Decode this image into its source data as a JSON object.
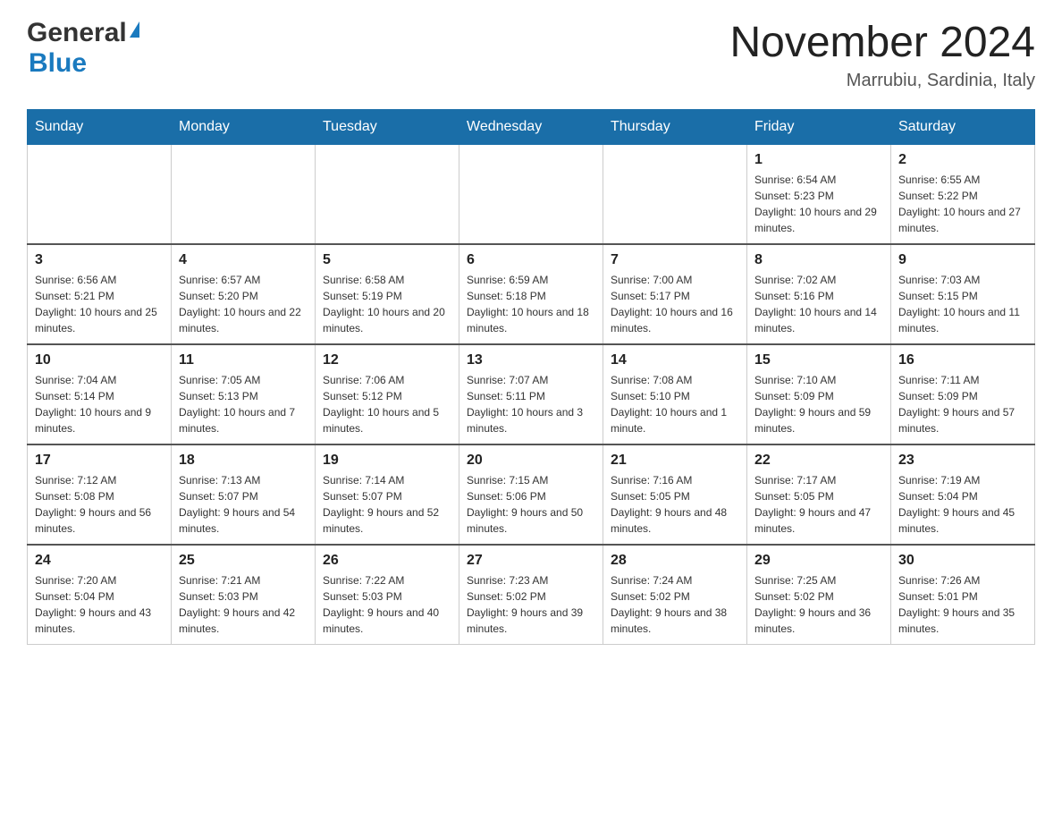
{
  "header": {
    "logo_general": "General",
    "logo_blue": "Blue",
    "month_title": "November 2024",
    "location": "Marrubiu, Sardinia, Italy"
  },
  "weekdays": [
    "Sunday",
    "Monday",
    "Tuesday",
    "Wednesday",
    "Thursday",
    "Friday",
    "Saturday"
  ],
  "weeks": [
    {
      "days": [
        {
          "number": "",
          "sunrise": "",
          "sunset": "",
          "daylight": "",
          "empty": true
        },
        {
          "number": "",
          "sunrise": "",
          "sunset": "",
          "daylight": "",
          "empty": true
        },
        {
          "number": "",
          "sunrise": "",
          "sunset": "",
          "daylight": "",
          "empty": true
        },
        {
          "number": "",
          "sunrise": "",
          "sunset": "",
          "daylight": "",
          "empty": true
        },
        {
          "number": "",
          "sunrise": "",
          "sunset": "",
          "daylight": "",
          "empty": true
        },
        {
          "number": "1",
          "sunrise": "Sunrise: 6:54 AM",
          "sunset": "Sunset: 5:23 PM",
          "daylight": "Daylight: 10 hours and 29 minutes.",
          "empty": false
        },
        {
          "number": "2",
          "sunrise": "Sunrise: 6:55 AM",
          "sunset": "Sunset: 5:22 PM",
          "daylight": "Daylight: 10 hours and 27 minutes.",
          "empty": false
        }
      ]
    },
    {
      "days": [
        {
          "number": "3",
          "sunrise": "Sunrise: 6:56 AM",
          "sunset": "Sunset: 5:21 PM",
          "daylight": "Daylight: 10 hours and 25 minutes.",
          "empty": false
        },
        {
          "number": "4",
          "sunrise": "Sunrise: 6:57 AM",
          "sunset": "Sunset: 5:20 PM",
          "daylight": "Daylight: 10 hours and 22 minutes.",
          "empty": false
        },
        {
          "number": "5",
          "sunrise": "Sunrise: 6:58 AM",
          "sunset": "Sunset: 5:19 PM",
          "daylight": "Daylight: 10 hours and 20 minutes.",
          "empty": false
        },
        {
          "number": "6",
          "sunrise": "Sunrise: 6:59 AM",
          "sunset": "Sunset: 5:18 PM",
          "daylight": "Daylight: 10 hours and 18 minutes.",
          "empty": false
        },
        {
          "number": "7",
          "sunrise": "Sunrise: 7:00 AM",
          "sunset": "Sunset: 5:17 PM",
          "daylight": "Daylight: 10 hours and 16 minutes.",
          "empty": false
        },
        {
          "number": "8",
          "sunrise": "Sunrise: 7:02 AM",
          "sunset": "Sunset: 5:16 PM",
          "daylight": "Daylight: 10 hours and 14 minutes.",
          "empty": false
        },
        {
          "number": "9",
          "sunrise": "Sunrise: 7:03 AM",
          "sunset": "Sunset: 5:15 PM",
          "daylight": "Daylight: 10 hours and 11 minutes.",
          "empty": false
        }
      ]
    },
    {
      "days": [
        {
          "number": "10",
          "sunrise": "Sunrise: 7:04 AM",
          "sunset": "Sunset: 5:14 PM",
          "daylight": "Daylight: 10 hours and 9 minutes.",
          "empty": false
        },
        {
          "number": "11",
          "sunrise": "Sunrise: 7:05 AM",
          "sunset": "Sunset: 5:13 PM",
          "daylight": "Daylight: 10 hours and 7 minutes.",
          "empty": false
        },
        {
          "number": "12",
          "sunrise": "Sunrise: 7:06 AM",
          "sunset": "Sunset: 5:12 PM",
          "daylight": "Daylight: 10 hours and 5 minutes.",
          "empty": false
        },
        {
          "number": "13",
          "sunrise": "Sunrise: 7:07 AM",
          "sunset": "Sunset: 5:11 PM",
          "daylight": "Daylight: 10 hours and 3 minutes.",
          "empty": false
        },
        {
          "number": "14",
          "sunrise": "Sunrise: 7:08 AM",
          "sunset": "Sunset: 5:10 PM",
          "daylight": "Daylight: 10 hours and 1 minute.",
          "empty": false
        },
        {
          "number": "15",
          "sunrise": "Sunrise: 7:10 AM",
          "sunset": "Sunset: 5:09 PM",
          "daylight": "Daylight: 9 hours and 59 minutes.",
          "empty": false
        },
        {
          "number": "16",
          "sunrise": "Sunrise: 7:11 AM",
          "sunset": "Sunset: 5:09 PM",
          "daylight": "Daylight: 9 hours and 57 minutes.",
          "empty": false
        }
      ]
    },
    {
      "days": [
        {
          "number": "17",
          "sunrise": "Sunrise: 7:12 AM",
          "sunset": "Sunset: 5:08 PM",
          "daylight": "Daylight: 9 hours and 56 minutes.",
          "empty": false
        },
        {
          "number": "18",
          "sunrise": "Sunrise: 7:13 AM",
          "sunset": "Sunset: 5:07 PM",
          "daylight": "Daylight: 9 hours and 54 minutes.",
          "empty": false
        },
        {
          "number": "19",
          "sunrise": "Sunrise: 7:14 AM",
          "sunset": "Sunset: 5:07 PM",
          "daylight": "Daylight: 9 hours and 52 minutes.",
          "empty": false
        },
        {
          "number": "20",
          "sunrise": "Sunrise: 7:15 AM",
          "sunset": "Sunset: 5:06 PM",
          "daylight": "Daylight: 9 hours and 50 minutes.",
          "empty": false
        },
        {
          "number": "21",
          "sunrise": "Sunrise: 7:16 AM",
          "sunset": "Sunset: 5:05 PM",
          "daylight": "Daylight: 9 hours and 48 minutes.",
          "empty": false
        },
        {
          "number": "22",
          "sunrise": "Sunrise: 7:17 AM",
          "sunset": "Sunset: 5:05 PM",
          "daylight": "Daylight: 9 hours and 47 minutes.",
          "empty": false
        },
        {
          "number": "23",
          "sunrise": "Sunrise: 7:19 AM",
          "sunset": "Sunset: 5:04 PM",
          "daylight": "Daylight: 9 hours and 45 minutes.",
          "empty": false
        }
      ]
    },
    {
      "days": [
        {
          "number": "24",
          "sunrise": "Sunrise: 7:20 AM",
          "sunset": "Sunset: 5:04 PM",
          "daylight": "Daylight: 9 hours and 43 minutes.",
          "empty": false
        },
        {
          "number": "25",
          "sunrise": "Sunrise: 7:21 AM",
          "sunset": "Sunset: 5:03 PM",
          "daylight": "Daylight: 9 hours and 42 minutes.",
          "empty": false
        },
        {
          "number": "26",
          "sunrise": "Sunrise: 7:22 AM",
          "sunset": "Sunset: 5:03 PM",
          "daylight": "Daylight: 9 hours and 40 minutes.",
          "empty": false
        },
        {
          "number": "27",
          "sunrise": "Sunrise: 7:23 AM",
          "sunset": "Sunset: 5:02 PM",
          "daylight": "Daylight: 9 hours and 39 minutes.",
          "empty": false
        },
        {
          "number": "28",
          "sunrise": "Sunrise: 7:24 AM",
          "sunset": "Sunset: 5:02 PM",
          "daylight": "Daylight: 9 hours and 38 minutes.",
          "empty": false
        },
        {
          "number": "29",
          "sunrise": "Sunrise: 7:25 AM",
          "sunset": "Sunset: 5:02 PM",
          "daylight": "Daylight: 9 hours and 36 minutes.",
          "empty": false
        },
        {
          "number": "30",
          "sunrise": "Sunrise: 7:26 AM",
          "sunset": "Sunset: 5:01 PM",
          "daylight": "Daylight: 9 hours and 35 minutes.",
          "empty": false
        }
      ]
    }
  ]
}
